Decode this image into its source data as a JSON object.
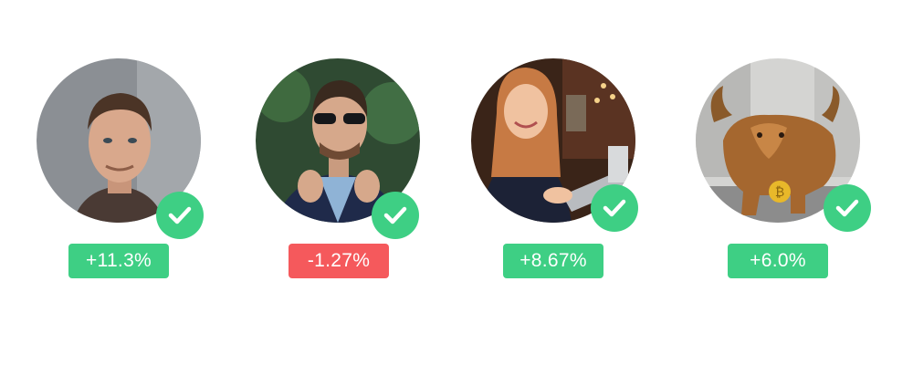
{
  "colors": {
    "positive": "#3ecf84",
    "negative": "#f5595c",
    "check_background": "#3ecf84",
    "check_mark": "#ffffff"
  },
  "cards": [
    {
      "avatar_subject": "man portrait",
      "verified_icon": "check-icon",
      "change": "+11.3%",
      "trend": "positive"
    },
    {
      "avatar_subject": "man with sunglasses",
      "verified_icon": "check-icon",
      "change": "-1.27%",
      "trend": "negative"
    },
    {
      "avatar_subject": "smiling woman with laptop",
      "verified_icon": "check-icon",
      "change": "+8.67%",
      "trend": "positive"
    },
    {
      "avatar_subject": "bull statue with bitcoin",
      "verified_icon": "check-icon",
      "change": "+6.0%",
      "trend": "positive"
    }
  ]
}
